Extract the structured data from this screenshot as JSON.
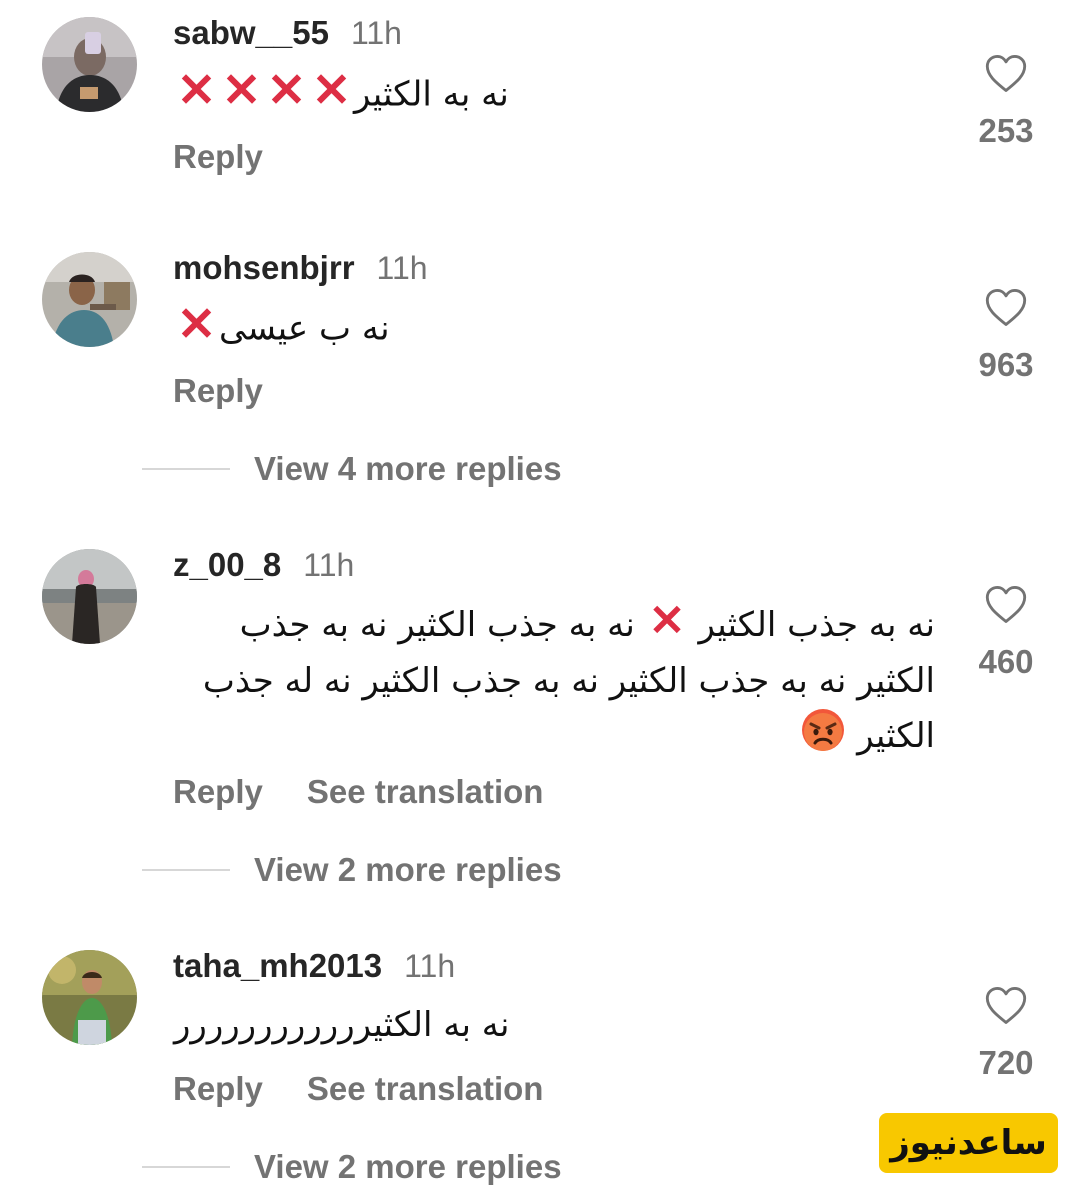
{
  "comments": [
    {
      "username": "sabw__55",
      "time": "11h",
      "text": "نه به الکثیر",
      "emoji": "xxxx",
      "reply_label": "Reply",
      "likes": "253"
    },
    {
      "username": "mohsenbjrr",
      "time": "11h",
      "text": "نه ب عیسی",
      "emoji": "x",
      "reply_label": "Reply",
      "likes": "963",
      "view_more": "View 4 more replies"
    },
    {
      "username": "z_00_8",
      "time": "11h",
      "text_part1": "نه به جذب  الکثیر ",
      "text_part2": " نه به جذب الکثیر  نه به جذب الکثیر  نه به جذب الکثیر  نه به جذب الکثیر  نه له جذب الکثیر ",
      "emoji": "angry",
      "reply_label": "Reply",
      "translate_label": "See translation",
      "likes": "460",
      "view_more": "View 2 more replies"
    },
    {
      "username": "taha_mh2013",
      "time": "11h",
      "text": "نه به الکثیرررررررررررر",
      "reply_label": "Reply",
      "translate_label": "See translation",
      "likes": "720",
      "view_more": "View 2 more replies"
    }
  ],
  "icons": {
    "like": "heart-outline-icon",
    "cross": "red-cross-mark-emoji",
    "angry": "angry-face-emoji"
  },
  "colors": {
    "username": "#262626",
    "secondary": "#737373",
    "cross": "#dd2e44",
    "watermark_bg": "#f8c800"
  },
  "watermark": "ساعدنیوز"
}
